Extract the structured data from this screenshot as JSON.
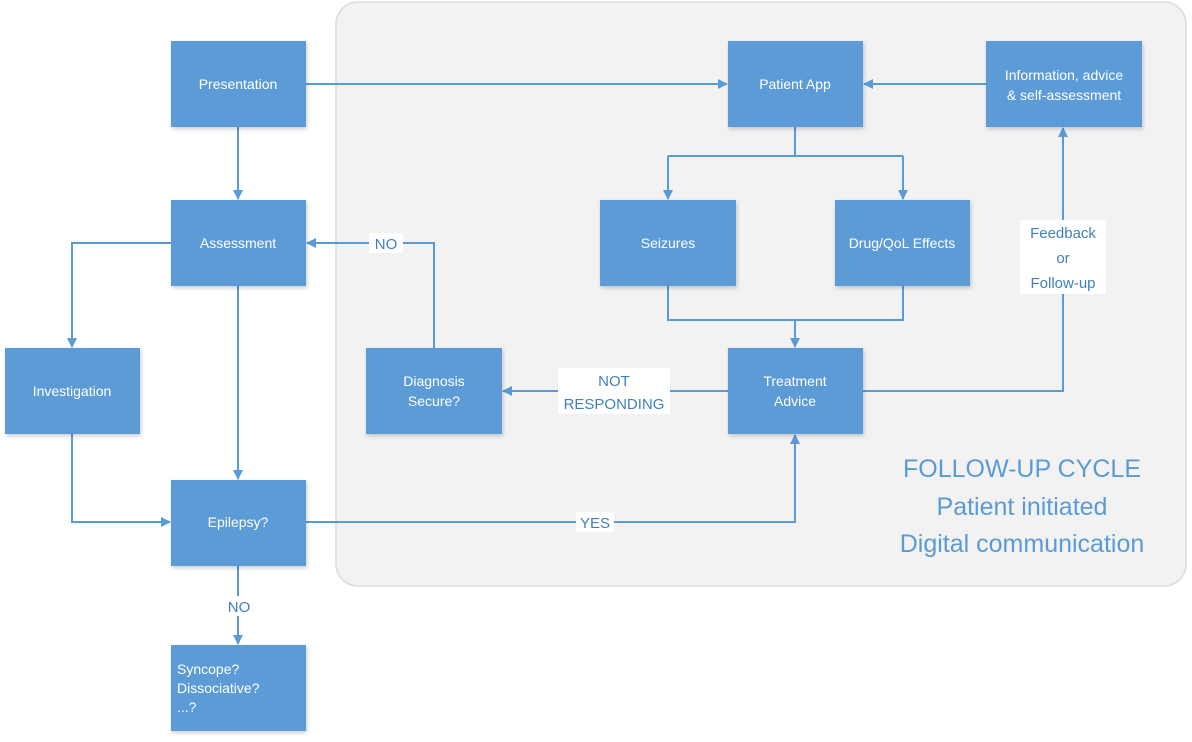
{
  "colors": {
    "box": "#5b9bd5",
    "panel": "#f2f2f2",
    "line": "#5b9bd5"
  },
  "nodes": {
    "presentation": [
      "Presentation"
    ],
    "assessment": [
      "Assessment"
    ],
    "investigation": [
      "Investigation"
    ],
    "epilepsy": [
      "Epilepsy?"
    ],
    "syncope": [
      "Syncope?",
      "Dissociative?",
      "...?"
    ],
    "patient_app": [
      "Patient App"
    ],
    "information": [
      "Information, advice",
      "& self-assessment"
    ],
    "seizures": [
      "Seizures"
    ],
    "drug_qol": [
      "Drug/QoL Effects"
    ],
    "treatment": [
      "Treatment",
      "Advice"
    ],
    "diagnosis": [
      "Diagnosis",
      "Secure?"
    ]
  },
  "edge_labels": {
    "epilepsy_no": "NO",
    "diagnosis_no": "NO",
    "yes": "YES",
    "not_responding": [
      "NOT",
      "RESPONDING"
    ],
    "feedback": [
      "Feedback",
      "or",
      "Follow-up"
    ]
  },
  "panel_caption": [
    "FOLLOW-UP CYCLE",
    "Patient initiated",
    "Digital communication"
  ]
}
